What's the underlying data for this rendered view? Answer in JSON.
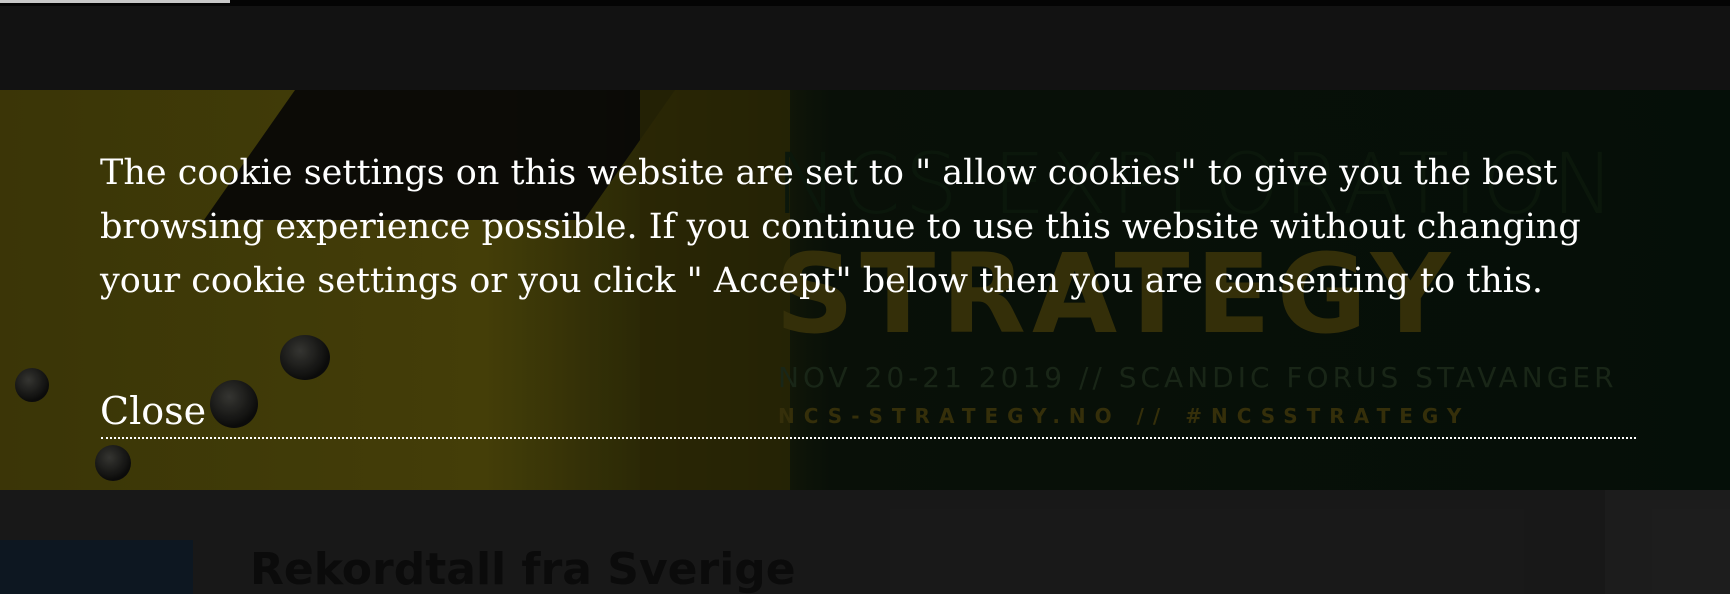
{
  "background_page": {
    "hero_banner": {
      "line1": "NCS EXPLORATION",
      "line2": "STRATEGY",
      "line3": "NOV 20-21 2019 // SCANDIC FORUS STAVANGER",
      "line4": "NCS-STRATEGY.NO  //  #NCSSTRATEGY"
    },
    "article_title": "Rekordtall fra Sverige"
  },
  "cookie_notice": {
    "message": "The cookie settings on this website are set to \" allow cookies\"  to give you the best browsing experience possible. If you continue to use this website without changing your cookie settings or you click \" Accept\"  below then you are consenting to this.",
    "close_label": "Close",
    "text_color": "#ffffff"
  }
}
